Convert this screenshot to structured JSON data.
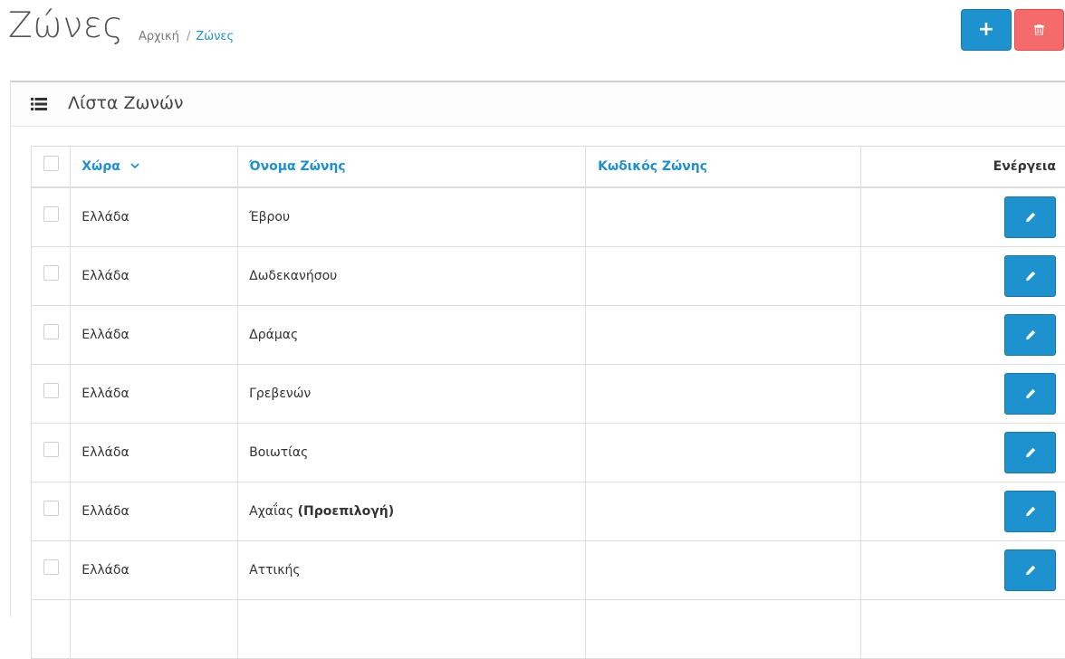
{
  "header": {
    "title": "Ζώνες",
    "breadcrumb": [
      {
        "label": "Αρχική"
      },
      {
        "label": "Ζώνες"
      }
    ],
    "breadcrumb_separator": "/",
    "add_icon": "plus-icon",
    "delete_icon": "trash-icon"
  },
  "panel": {
    "title": "Λίστα Ζωνών",
    "icon": "list-icon"
  },
  "table": {
    "columns": {
      "country": "Χώρα",
      "zone_name": "Όνομα Ζώνης",
      "zone_code": "Κωδικός Ζώνης",
      "action": "Ενέργεια"
    },
    "sort_icon": "chevron-down-icon",
    "rows": [
      {
        "country": "Ελλάδα",
        "zone_name": "Έβρου",
        "zone_code": "",
        "default_tag": ""
      },
      {
        "country": "Ελλάδα",
        "zone_name": "Δωδεκανήσου",
        "zone_code": "",
        "default_tag": ""
      },
      {
        "country": "Ελλάδα",
        "zone_name": "Δράμας",
        "zone_code": "",
        "default_tag": ""
      },
      {
        "country": "Ελλάδα",
        "zone_name": "Γρεβενών",
        "zone_code": "",
        "default_tag": ""
      },
      {
        "country": "Ελλάδα",
        "zone_name": "Βοιωτίας",
        "zone_code": "",
        "default_tag": ""
      },
      {
        "country": "Ελλάδα",
        "zone_name": "Αχαΐας",
        "zone_code": "",
        "default_tag": "(Προεπιλογή)"
      },
      {
        "country": "Ελλάδα",
        "zone_name": "Αττικής",
        "zone_code": "",
        "default_tag": ""
      },
      {
        "country": "",
        "zone_name": "",
        "zone_code": "",
        "default_tag": ""
      }
    ],
    "edit_icon": "pencil-icon"
  },
  "colors": {
    "primary": "#1e91cf",
    "danger": "#f56b6b",
    "border": "#dddddd"
  }
}
